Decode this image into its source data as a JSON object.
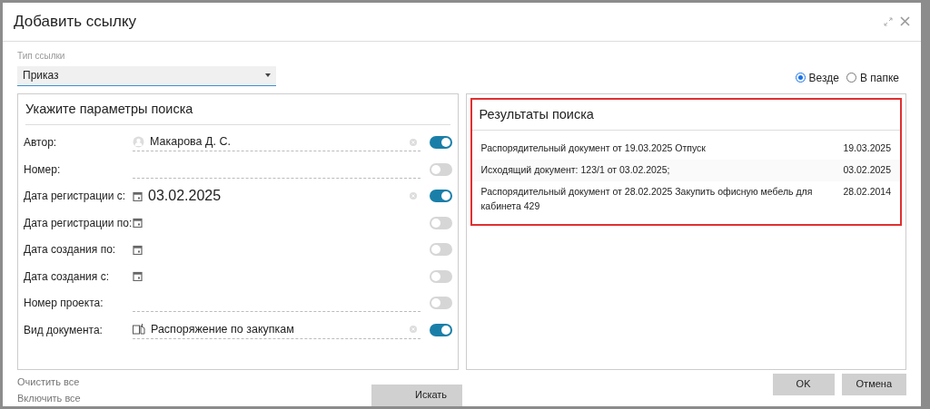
{
  "window": {
    "title": "Добавить ссылку"
  },
  "link_type": {
    "label": "Тип ссылки",
    "value": "Приказ"
  },
  "scope": [
    {
      "label": "Везде",
      "selected": true
    },
    {
      "label": "В папке",
      "selected": false
    }
  ],
  "params_panel": {
    "title": "Укажите параметры поиска",
    "fields": [
      {
        "label": "Автор:",
        "kind": "person",
        "value": "Макарова Д. С.",
        "on": true
      },
      {
        "label": "Номер:",
        "kind": "text",
        "on": false
      },
      {
        "label": "Дата регистрации с:",
        "kind": "date",
        "value": "03.02.2025",
        "on": true
      },
      {
        "label": "Дата регистрации по:",
        "kind": "date",
        "on": false
      },
      {
        "label": "Дата создания по:",
        "kind": "date",
        "on": false
      },
      {
        "label": "Дата создания с:",
        "kind": "date",
        "on": false
      },
      {
        "label": "Номер проекта:",
        "kind": "text",
        "on": false
      },
      {
        "label": "Вид документа:",
        "kind": "doctype",
        "value": "Распоряжение по закупкам",
        "on": true
      }
    ]
  },
  "results_panel": {
    "title": "Результаты поиска",
    "rows": [
      {
        "name": "Распорядительный документ от 19.03.2025 Отпуск",
        "date": "19.03.2025"
      },
      {
        "name": "Исходящий документ: 123/1 от 03.02.2025;",
        "date": "03.02.2025"
      },
      {
        "name": "Распорядительный документ от 28.02.2025 Закупить офисную мебель для кабинета 429",
        "date": "28.02.2014"
      }
    ]
  },
  "links": [
    "Очистить все",
    "Включить все"
  ],
  "search_button": "Искать",
  "buttons": [
    "OK",
    "Отмена"
  ]
}
